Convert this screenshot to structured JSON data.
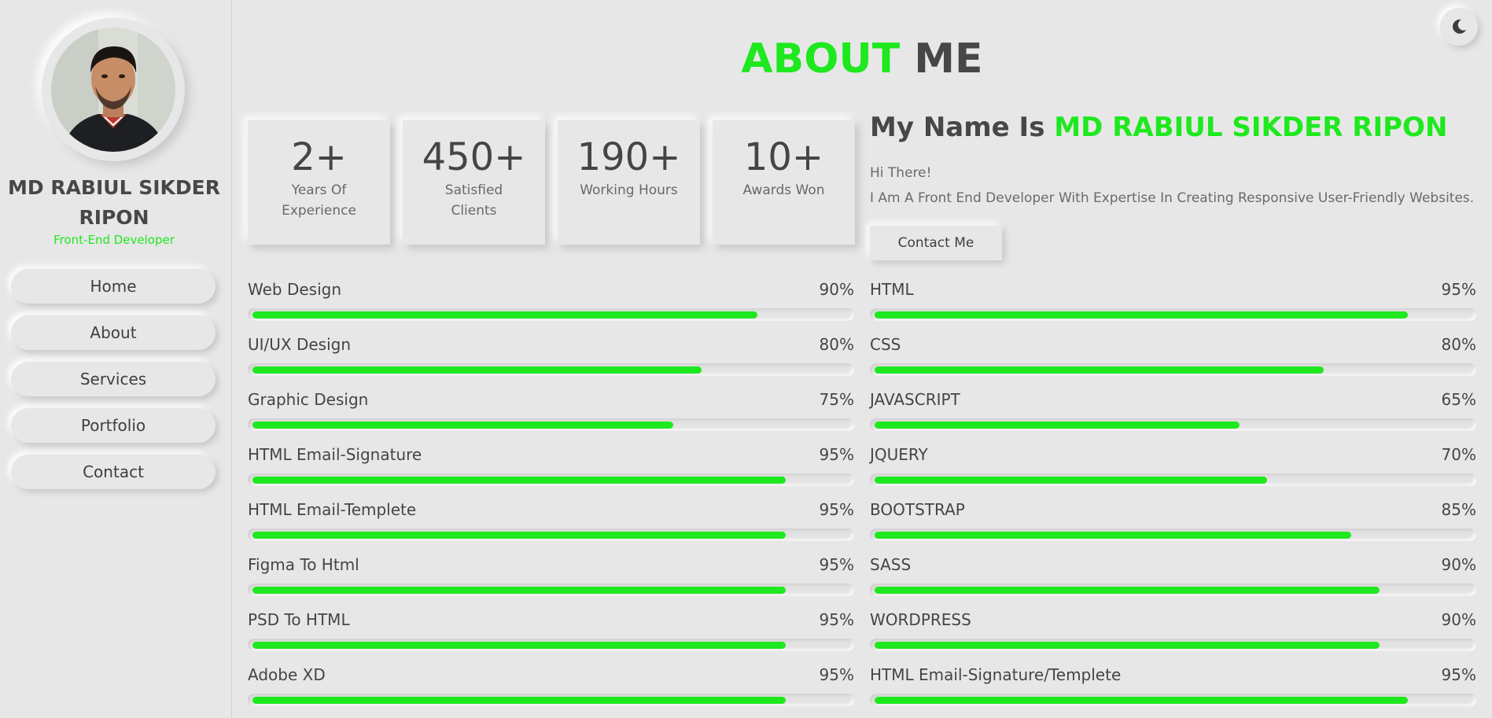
{
  "colors": {
    "accent": "#1ee81e",
    "background": "#e7e7e7",
    "text": "#474747"
  },
  "profile": {
    "name": "MD RABIUL SIKDER RIPON",
    "role": "Front-End Developer"
  },
  "nav": {
    "items": [
      {
        "label": "Home"
      },
      {
        "label": "About"
      },
      {
        "label": "Services"
      },
      {
        "label": "Portfolio"
      },
      {
        "label": "Contact"
      }
    ]
  },
  "theme_toggle": {
    "icon": "moon-icon"
  },
  "title": {
    "accent": "ABOUT",
    "rest": "ME"
  },
  "stats": [
    {
      "value": "2+",
      "label": "Years Of Experience"
    },
    {
      "value": "450+",
      "label": "Satisfied Clients"
    },
    {
      "value": "190+",
      "label": "Working Hours"
    },
    {
      "value": "10+",
      "label": "Awards Won"
    }
  ],
  "intro": {
    "heading_prefix": "My Name Is",
    "heading_name": "MD RABIUL SIKDER RIPON",
    "greeting": "Hi There!",
    "text": "I Am A Front End Developer With Expertise In Creating Responsive User-Friendly Websites.",
    "contact_label": "Contact Me"
  },
  "skills_left": [
    {
      "name": "Web Design",
      "percent": 90,
      "label": "90%"
    },
    {
      "name": "UI/UX Design",
      "percent": 80,
      "label": "80%"
    },
    {
      "name": "Graphic Design",
      "percent": 75,
      "label": "75%"
    },
    {
      "name": "HTML Email-Signature",
      "percent": 95,
      "label": "95%"
    },
    {
      "name": "HTML Email-Templete",
      "percent": 95,
      "label": "95%"
    },
    {
      "name": "Figma To Html",
      "percent": 95,
      "label": "95%"
    },
    {
      "name": "PSD To HTML",
      "percent": 95,
      "label": "95%"
    },
    {
      "name": "Adobe XD",
      "percent": 95,
      "label": "95%"
    }
  ],
  "skills_right": [
    {
      "name": "HTML",
      "percent": 95,
      "label": "95%"
    },
    {
      "name": "CSS",
      "percent": 80,
      "label": "80%"
    },
    {
      "name": "JAVASCRIPT",
      "percent": 65,
      "label": "65%"
    },
    {
      "name": "JQUERY",
      "percent": 70,
      "label": "70%"
    },
    {
      "name": "BOOTSTRAP",
      "percent": 85,
      "label": "85%"
    },
    {
      "name": "SASS",
      "percent": 90,
      "label": "90%"
    },
    {
      "name": "WORDPRESS",
      "percent": 90,
      "label": "90%"
    },
    {
      "name": "HTML Email-Signature/Templete",
      "percent": 95,
      "label": "95%"
    }
  ]
}
